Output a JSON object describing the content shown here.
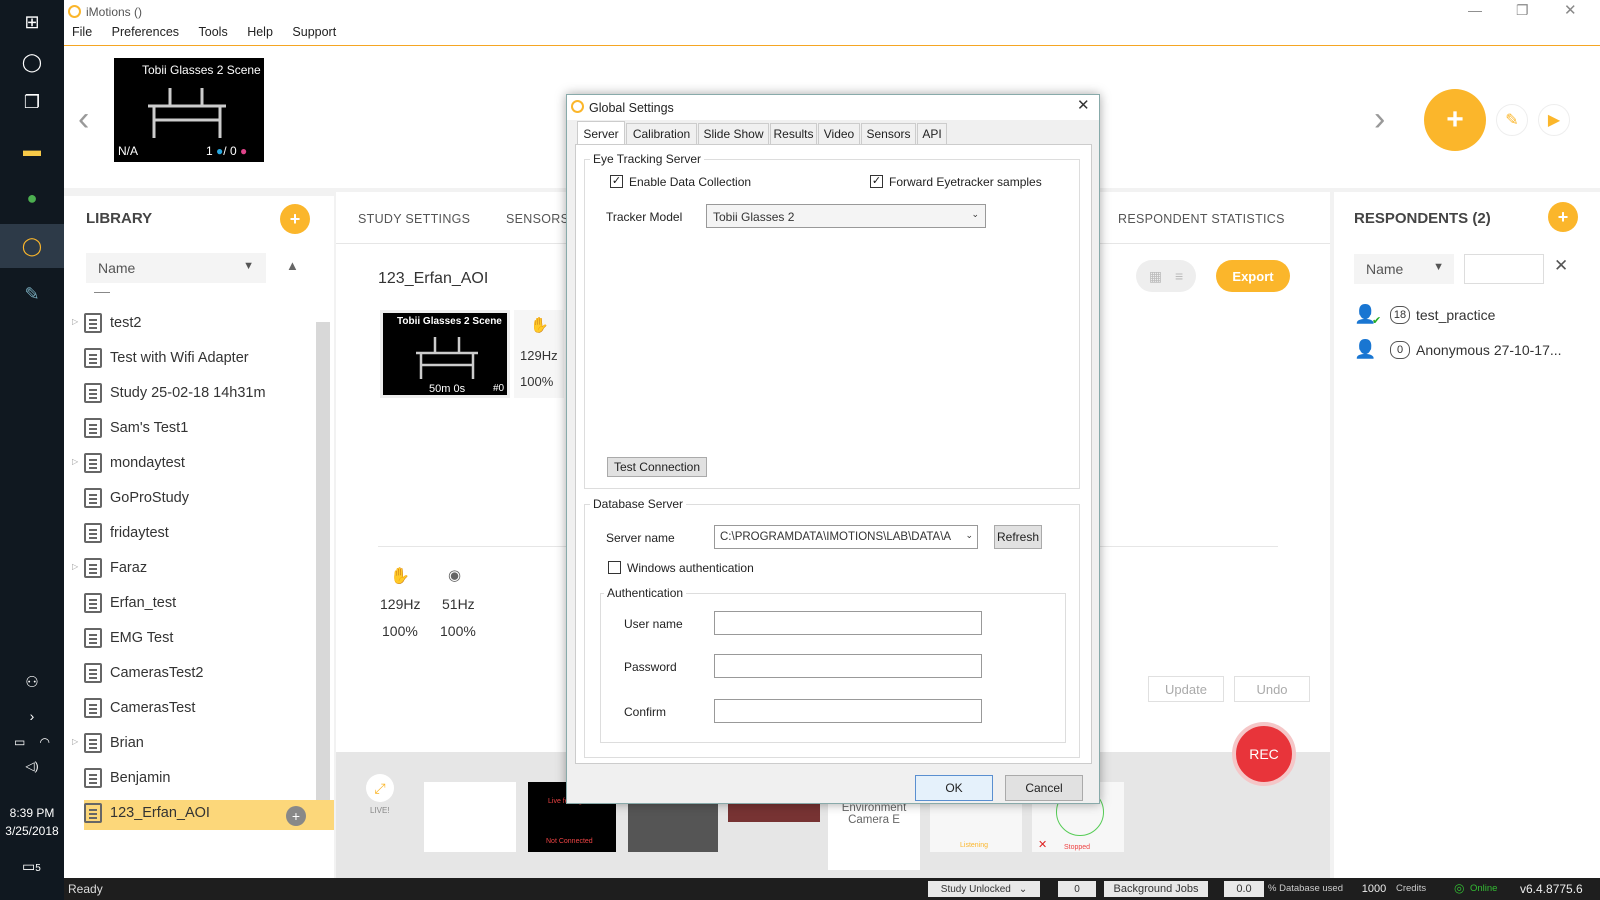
{
  "window": {
    "title": "iMotions ()"
  },
  "menu": [
    "File",
    "Preferences",
    "Tools",
    "Help",
    "Support"
  ],
  "taskbar": {
    "time": "8:39 PM",
    "date": "3/25/2018",
    "notifications": "5"
  },
  "stimulus_bar": {
    "scene_title": "Tobii Glasses 2 Scene",
    "scene_na": "N/A",
    "count_a": "1",
    "count_sep": "/ 0"
  },
  "library": {
    "title": "LIBRARY",
    "sort": "Name",
    "items": [
      "test2",
      "Test with Wifi Adapter",
      "Study 25-02-18 14h31m",
      "Sam's Test1",
      "mondaytest",
      "GoProStudy",
      "fridaytest",
      "Faraz",
      "Erfan_test",
      "EMG Test",
      "CamerasTest2",
      "CamerasTest",
      "Brian",
      "Benjamin",
      "123_Erfan_AOI"
    ]
  },
  "center": {
    "tabs": [
      "STUDY SETTINGS",
      "SENSORS",
      "RESPONDENT STATISTICS"
    ],
    "study_name": "123_Erfan_AOI",
    "scene_card": {
      "title": "Tobii Glasses 2 Scene",
      "duration": "50m 0s",
      "index": "#0"
    },
    "card_sensor": {
      "hz": "129Hz",
      "pct": "100%"
    },
    "sensors": [
      {
        "icon": "hand-icon",
        "hz": "129Hz",
        "pct": "100%"
      },
      {
        "icon": "eye-icon",
        "hz": "51Hz",
        "pct": "100%"
      }
    ],
    "export": "Export",
    "update": "Update",
    "undo": "Undo",
    "rec": "REC",
    "live": "LIVE!",
    "live_feed": "Live feed goes here",
    "not_connected": "Not Connected",
    "env_camera": "Environment Camera E",
    "listening": "Listening",
    "stopped": "Stopped"
  },
  "respondents": {
    "title": "RESPONDENTS (2)",
    "sort": "Name",
    "items": [
      {
        "count": "18",
        "name": "test_practice"
      },
      {
        "count": "0",
        "name": "Anonymous 27-10-17..."
      }
    ]
  },
  "dialog": {
    "title": "Global Settings",
    "tabs": [
      "Server",
      "Calibration",
      "Slide Show",
      "Results",
      "Video",
      "Sensors",
      "API"
    ],
    "eye_tracking": {
      "group": "Eye Tracking Server",
      "enable_data": "Enable Data Collection",
      "forward": "Forward Eyetracker samples",
      "tracker_label": "Tracker Model",
      "tracker_value": "Tobii Glasses 2",
      "test_conn": "Test Connection"
    },
    "database": {
      "group": "Database Server",
      "server_label": "Server name",
      "server_value": "C:\\PROGRAMDATA\\IMOTIONS\\LAB\\DATA\\A",
      "refresh": "Refresh",
      "win_auth": "Windows authentication",
      "auth_group": "Authentication",
      "user": "User  name",
      "password": "Password",
      "confirm": "Confirm"
    },
    "ok": "OK",
    "cancel": "Cancel"
  },
  "status": {
    "ready": "Ready",
    "study_lock": "Study Unlocked",
    "jobs_count": "0",
    "jobs": "Background Jobs",
    "db_pct": "0.0",
    "db_label": "% Database used",
    "credits_n": "1000",
    "credits": "Credits",
    "online": "Online",
    "version": "v6.4.8775.6"
  },
  "colors": {
    "accent": "#fbb62b",
    "rec": "#e8343a",
    "selected": "#fcd77a"
  }
}
